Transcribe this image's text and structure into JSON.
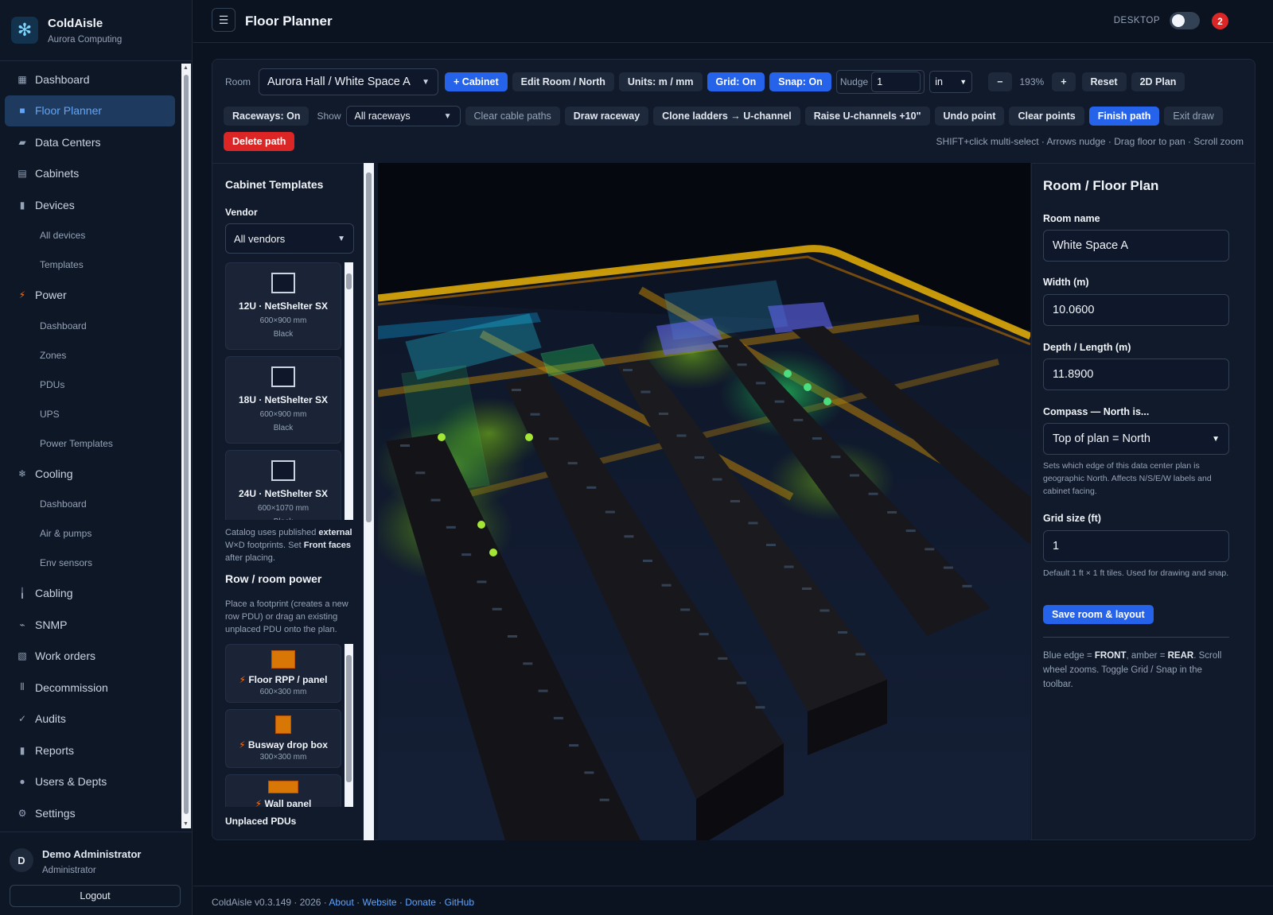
{
  "app": {
    "name": "ColdAisle",
    "org": "Aurora Computing"
  },
  "sidebar": {
    "items": [
      {
        "label": "Dashboard",
        "icon": "grid-icon"
      },
      {
        "label": "Floor Planner",
        "icon": "floorplan-icon",
        "active": true
      },
      {
        "label": "Data Centers",
        "icon": "building-icon"
      },
      {
        "label": "Cabinets",
        "icon": "cabinet-icon"
      },
      {
        "label": "Devices",
        "icon": "device-icon"
      },
      {
        "label": "All devices",
        "sub": true
      },
      {
        "label": "Templates",
        "sub": true
      },
      {
        "label": "Power",
        "icon": "bolt-icon"
      },
      {
        "label": "Dashboard",
        "sub": true
      },
      {
        "label": "Zones",
        "sub": true
      },
      {
        "label": "PDUs",
        "sub": true
      },
      {
        "label": "UPS",
        "sub": true
      },
      {
        "label": "Power Templates",
        "sub": true
      },
      {
        "label": "Cooling",
        "icon": "snowflake-icon"
      },
      {
        "label": "Dashboard",
        "sub": true
      },
      {
        "label": "Air & pumps",
        "sub": true
      },
      {
        "label": "Env sensors",
        "sub": true
      },
      {
        "label": "Cabling",
        "icon": "cable-icon"
      },
      {
        "label": "SNMP",
        "icon": "satellite-icon"
      },
      {
        "label": "Work orders",
        "icon": "clipboard-icon"
      },
      {
        "label": "Decommission",
        "icon": "decommission-icon"
      },
      {
        "label": "Audits",
        "icon": "check-icon"
      },
      {
        "label": "Reports",
        "icon": "chart-icon"
      },
      {
        "label": "Users & Depts",
        "icon": "user-icon"
      },
      {
        "label": "Settings",
        "icon": "gear-icon"
      }
    ],
    "user": {
      "initial": "D",
      "name": "Demo Administrator",
      "role": "Administrator",
      "logout": "Logout"
    }
  },
  "header": {
    "title": "Floor Planner",
    "desktop_label": "DESKTOP",
    "notifications": "2"
  },
  "toolbar": {
    "room_label": "Room",
    "room_value": "Aurora Hall / White Space A",
    "add_cabinet": "+ Cabinet",
    "edit_room": "Edit Room / North",
    "units": "Units: m / mm",
    "grid": "Grid: On",
    "snap": "Snap: On",
    "nudge_label": "Nudge",
    "nudge_value": "1",
    "nudge_unit": "in",
    "zoom_minus": "−",
    "zoom": "193%",
    "zoom_plus": "+",
    "reset": "Reset",
    "plan2d": "2D Plan",
    "raceways": "Raceways: On",
    "show_label": "Show",
    "show_value": "All raceways",
    "clear_cable": "Clear cable paths",
    "draw_raceway": "Draw raceway",
    "clone_ladders": "Clone ladders → U-channel",
    "raise_uchannels": "Raise U-channels +10\"",
    "undo_point": "Undo point",
    "clear_points": "Clear points",
    "finish_path": "Finish path",
    "exit_draw": "Exit draw",
    "delete_path": "Delete path",
    "hint": "SHIFT+click multi-select · Arrows nudge · Drag floor to pan · Scroll zoom"
  },
  "templates": {
    "title": "Cabinet Templates",
    "vendor_label": "Vendor",
    "vendor_value": "All vendors",
    "cards": [
      {
        "name": "12U · NetShelter SX",
        "dims": "600×900 mm",
        "color": "Black"
      },
      {
        "name": "18U · NetShelter SX",
        "dims": "600×900 mm",
        "color": "Black"
      },
      {
        "name": "24U · NetShelter SX",
        "dims": "600×1070 mm",
        "color": "Black"
      }
    ],
    "note_pre": "Catalog uses published ",
    "note_ext": "external",
    "note_mid": " W×D footprints. Set ",
    "note_ff": "Front faces",
    "note_post": " after placing."
  },
  "power": {
    "title": "Row / room power",
    "desc": "Place a footprint (creates a new row PDU) or drag an existing unplaced PDU onto the plan.",
    "cards": [
      {
        "name": "Floor RPP / panel",
        "dims": "600×300 mm"
      },
      {
        "name": "Busway drop box",
        "dims": "300×300 mm"
      },
      {
        "name": "Wall panel",
        "dims": ""
      }
    ],
    "unplaced": "Unplaced PDUs"
  },
  "room": {
    "title": "Room / Floor Plan",
    "name_label": "Room name",
    "name_value": "White Space A",
    "width_label": "Width (m)",
    "width_value": "10.0600",
    "depth_label": "Depth / Length (m)",
    "depth_value": "11.8900",
    "compass_label": "Compass — North is...",
    "compass_value": "Top of plan = North",
    "compass_help": "Sets which edge of this data center plan is geographic North. Affects N/S/E/W labels and cabinet facing.",
    "grid_label": "Grid size (ft)",
    "grid_value": "1",
    "grid_help": "Default 1 ft × 1 ft tiles. Used for drawing and snap.",
    "save": "Save room & layout",
    "legend_a": "Blue edge = ",
    "legend_front": "FRONT",
    "legend_b": ", amber = ",
    "legend_rear": "REAR",
    "legend_c": ". Scroll wheel zooms. Toggle Grid / Snap in the toolbar."
  },
  "footer": {
    "version": "ColdAisle v0.3.149 · 2026 ·",
    "about": "About",
    "website": "Website",
    "donate": "Donate",
    "github": "GitHub"
  },
  "colors": {
    "accent": "#2563eb",
    "danger": "#dc2626",
    "raceway": "#eab308",
    "cabinet": "#1f1f24"
  }
}
